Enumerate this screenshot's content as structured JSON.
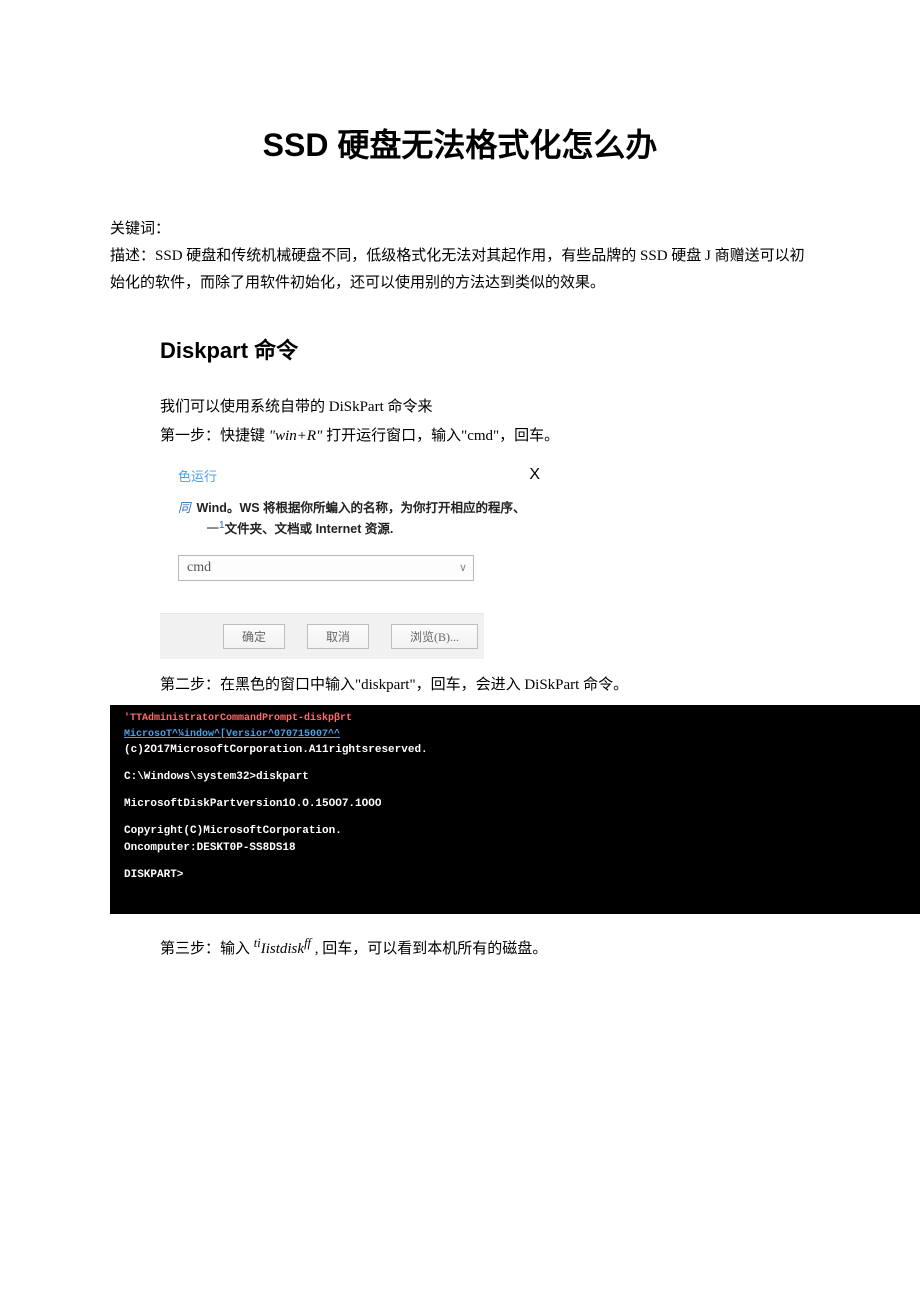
{
  "title": "SSD 硬盘无法格式化怎么办",
  "keywords_label": "关键词：",
  "description_label": "描述：",
  "description_text": "SSD 硬盘和传统机械硬盘不同，低级格式化无法对其起作用，有些品牌的 SSD 硬盘 J 商赠送可以初始化的软件，而除了用软件初始化，还可以使用别的方法达到类似的效果。",
  "section_heading": "Diskpart 命令",
  "intro_line": "我们可以使用系统自带的 DiSkPart 命令来",
  "step1_prefix": "第一步：快捷键",
  "step1_key": "\"win+R\"",
  "step1_suffix": "打开运行窗口，输入\"cmd\"，回车。",
  "run_dialog": {
    "title": "色运行",
    "close": "X",
    "icon_text": "同",
    "msg_line1_a": "Wind。WS 将根据你所蝙入的名称，为你打开相应的程序、",
    "msg_line2_prefix": "一",
    "msg_line2_sup": "1",
    "msg_line2_rest": "文件夹、文档或 Internet 资源.",
    "combo_value": "cmd",
    "btn_ok": "确定",
    "btn_cancel": "取消",
    "btn_browse": "浏览(B)..."
  },
  "step2": "第二步：在黑色的窗口中输入\"diskpart\"，回车，会进入 DiSkPart 命令。",
  "terminal": {
    "title_line": "'TTAdministratorCommandPrompt-diskpβrt",
    "version_line": "MicrosoT^¼indow^[Versior^070715007^^",
    "copyright1": "(c)2O17MicrosoftCorporation.A11rightsreserved.",
    "prompt1": "C:\\Windows\\system32>diskpart",
    "dp_version": "MicrosoftDiskPartversion1O.O.15OO7.1OOO",
    "dp_copy": "Copyright(C)MicrosoftCorporation.",
    "dp_computer": "Oncomputer:DESKT0P-SS8DS18",
    "dp_prompt": "DISKPART>"
  },
  "step3_prefix": "第三步：输入",
  "step3_cmd_pre": "ti",
  "step3_cmd_main": "Iistdisk",
  "step3_cmd_suf": "ff",
  "step3_suffix": ", 回车，可以看到本机所有的磁盘。"
}
